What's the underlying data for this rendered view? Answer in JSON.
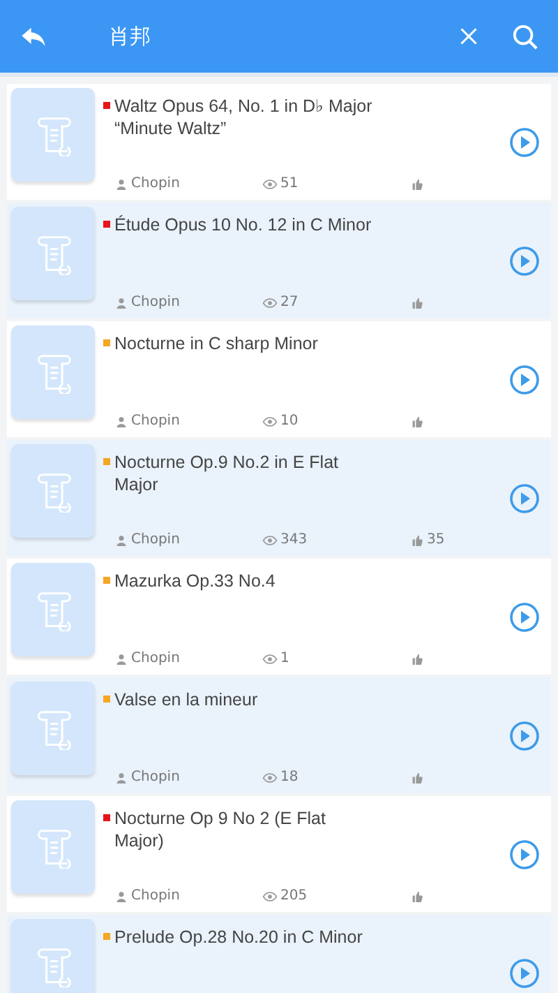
{
  "header": {
    "title": "肖邦"
  },
  "pieces": [
    {
      "title": "Waltz Opus 64, No. 1 in D♭ Major\n“Minute Waltz”",
      "color": "#e8141c",
      "composer": "Chopin",
      "views": "51"
    },
    {
      "title": "Étude Opus 10 No. 12 in C Minor",
      "color": "#e8141c",
      "composer": "Chopin",
      "views": "27"
    },
    {
      "title": "Nocturne in C sharp Minor",
      "color": "#f5a623",
      "composer": "Chopin",
      "views": "10"
    },
    {
      "title": "Nocturne Op.9 No.2 in E Flat\nMajor",
      "color": "#f5a623",
      "composer": "Chopin",
      "views": "343",
      "likes": "35"
    },
    {
      "title": "Mazurka Op.33 No.4",
      "color": "#f5a623",
      "composer": "Chopin",
      "views": "1"
    },
    {
      "title": "Valse en la mineur",
      "color": "#f5a623",
      "composer": "Chopin",
      "views": "18"
    },
    {
      "title": "Nocturne Op 9 No 2 (E Flat\nMajor)",
      "color": "#e8141c",
      "composer": "Chopin",
      "views": "205"
    },
    {
      "title": "Prelude Op.28 No.20 in C Minor",
      "color": "#f5a623"
    }
  ]
}
